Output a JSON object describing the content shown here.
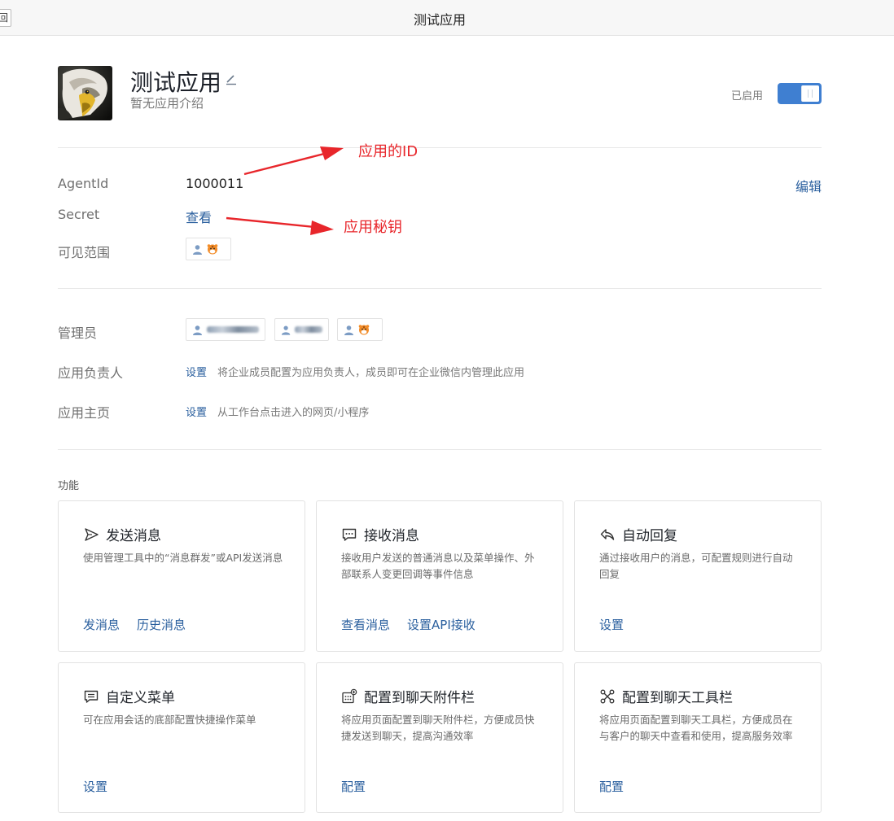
{
  "topbar": {
    "back_label": "回",
    "title": "测试应用"
  },
  "app": {
    "name": "测试应用",
    "description": "暂无应用介绍",
    "status_label": "已启用",
    "enabled": true
  },
  "details": {
    "agentid_label": "AgentId",
    "agentid_value": "1000011",
    "edit_label": "编辑",
    "secret_label": "Secret",
    "secret_link": "查看",
    "visibility_label": "可见范围"
  },
  "annotations": {
    "id_note": "应用的ID",
    "secret_note": "应用秘钥",
    "color": "#e8262b"
  },
  "admin": {
    "admins_label": "管理员",
    "owner_label": "应用负责人",
    "owner_link": "设置",
    "owner_desc": "将企业成员配置为应用负责人，成员即可在企业微信内管理此应用",
    "homepage_label": "应用主页",
    "homepage_link": "设置",
    "homepage_desc": "从工作台点击进入的网页/小程序"
  },
  "features": {
    "section_title": "功能",
    "cards": [
      {
        "title": "发送消息",
        "icon": "send-icon",
        "desc": "使用管理工具中的“消息群发”或API发送消息",
        "actions": [
          "发消息",
          "历史消息"
        ]
      },
      {
        "title": "接收消息",
        "icon": "message-bubble-icon",
        "desc": "接收用户发送的普通消息以及菜单操作、外部联系人变更回调等事件信息",
        "actions": [
          "查看消息",
          "设置API接收"
        ]
      },
      {
        "title": "自动回复",
        "icon": "reply-icon",
        "desc": "通过接收用户的消息，可配置规则进行自动回复",
        "actions": [
          "设置"
        ]
      },
      {
        "title": "自定义菜单",
        "icon": "menu-icon",
        "desc": "可在应用会话的底部配置快捷操作菜单",
        "actions": [
          "设置"
        ]
      },
      {
        "title": "配置到聊天附件栏",
        "icon": "attachment-bar-icon",
        "desc": "将应用页面配置到聊天附件栏，方便成员快捷发送到聊天，提高沟通效率",
        "actions": [
          "配置"
        ]
      },
      {
        "title": "配置到聊天工具栏",
        "icon": "toolbar-icon",
        "desc": "将应用页面配置到聊天工具栏，方便成员在与客户的聊天中查看和使用，提高服务效率",
        "actions": [
          "配置"
        ]
      }
    ]
  },
  "colors": {
    "link": "#2a5f9e",
    "toggle_on": "#3f7fd1",
    "annotation": "#e8262b"
  }
}
